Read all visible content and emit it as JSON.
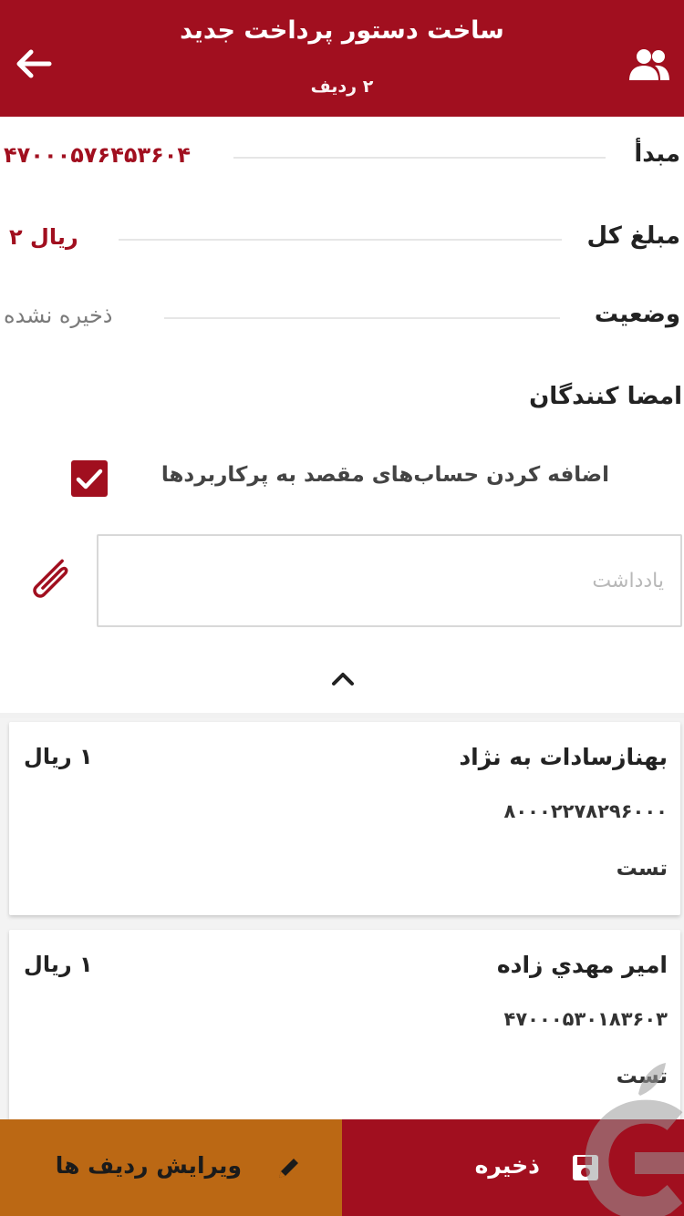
{
  "header": {
    "title": "ساخت دستور پرداخت جدید",
    "subtitle": "۲ ردیف"
  },
  "fields": {
    "source_label": "مبدأ",
    "source_value": "۴۷۰۰۰۵۷۶۴۵۳۶۰۴",
    "total_label": "مبلغ کل",
    "total_value": "۲ ریال",
    "status_label": "وضعیت",
    "status_value": "ذخیره نشده"
  },
  "signers_label": "امضا کنندگان",
  "add_destinations": {
    "label": "اضافه کردن حساب‌های مقصد به پرکاربردها",
    "checked": true
  },
  "note": {
    "placeholder": "یادداشت",
    "value": ""
  },
  "rows": [
    {
      "name": "بهنازسادات به نژاد",
      "amount": "۱ ریال",
      "account": "۸۰۰۰۲۲۷۸۲۹۶۰۰۰",
      "description": "تست"
    },
    {
      "name": "امير مهدي زاده",
      "amount": "۱ ریال",
      "account": "۴۷۰۰۰۵۳۰۱۸۳۶۰۳",
      "description": "تست"
    }
  ],
  "actions": {
    "save_label": "ذخیره",
    "edit_rows_label": "ویرایش ردیف ها"
  },
  "colors": {
    "primary": "#a10f1f",
    "accent": "#bb6814"
  },
  "icons": {
    "back": "arrow-left",
    "users": "users",
    "checkbox": "check",
    "attachment": "paperclip",
    "collapse": "chevron-up",
    "save": "floppy-disk",
    "edit": "pencil"
  }
}
